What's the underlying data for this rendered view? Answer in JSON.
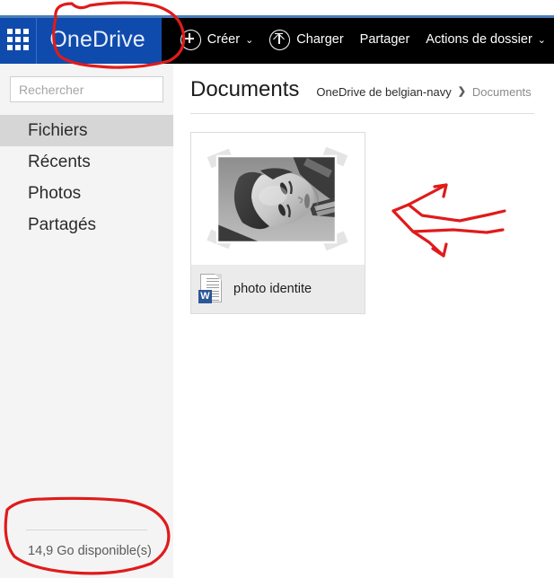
{
  "app": {
    "brand": "OneDrive",
    "waffle_icon": "app-launcher-grid-icon"
  },
  "toolbar": {
    "items": [
      {
        "label": "Créer",
        "icon": "plus-circle-icon",
        "has_caret": true
      },
      {
        "label": "Charger",
        "icon": "upload-circle-icon",
        "has_caret": false
      },
      {
        "label": "Partager",
        "icon": null,
        "has_caret": false
      },
      {
        "label": "Actions de dossier",
        "icon": null,
        "has_caret": true
      }
    ],
    "caret_glyph": "⌄"
  },
  "sidebar": {
    "search": {
      "placeholder": "Rechercher",
      "value": "",
      "icon": "search-icon"
    },
    "items": [
      {
        "label": "Fichiers",
        "selected": true
      },
      {
        "label": "Récents",
        "selected": false
      },
      {
        "label": "Photos",
        "selected": false
      },
      {
        "label": "Partagés",
        "selected": false
      }
    ],
    "storage_text": "14,9 Go disponible(s)"
  },
  "main": {
    "page_title": "Documents",
    "breadcrumb": {
      "root": "OneDrive de belgian-navy",
      "separator": "❯",
      "current": "Documents"
    },
    "tiles": [
      {
        "name": "photo identite",
        "file_icon": "word-document-icon",
        "file_icon_badge": "W",
        "thumbnail": "grayscale-portrait-photo"
      }
    ]
  },
  "annotations": {
    "color": "#e01b1b",
    "marks": [
      {
        "name": "circle-around-onedrive-brand",
        "shape": "ellipse"
      },
      {
        "name": "double-arrow-pointing-left",
        "shape": "arrow"
      },
      {
        "name": "circle-around-storage-text",
        "shape": "ellipse"
      }
    ]
  },
  "colors": {
    "brand_blue": "#0f4bac",
    "toolbar_black": "#000000",
    "sidebar_gray": "#f4f4f4",
    "selected_gray": "#d6d6d6",
    "annotation_red": "#e01b1b",
    "word_blue": "#2b5797"
  }
}
